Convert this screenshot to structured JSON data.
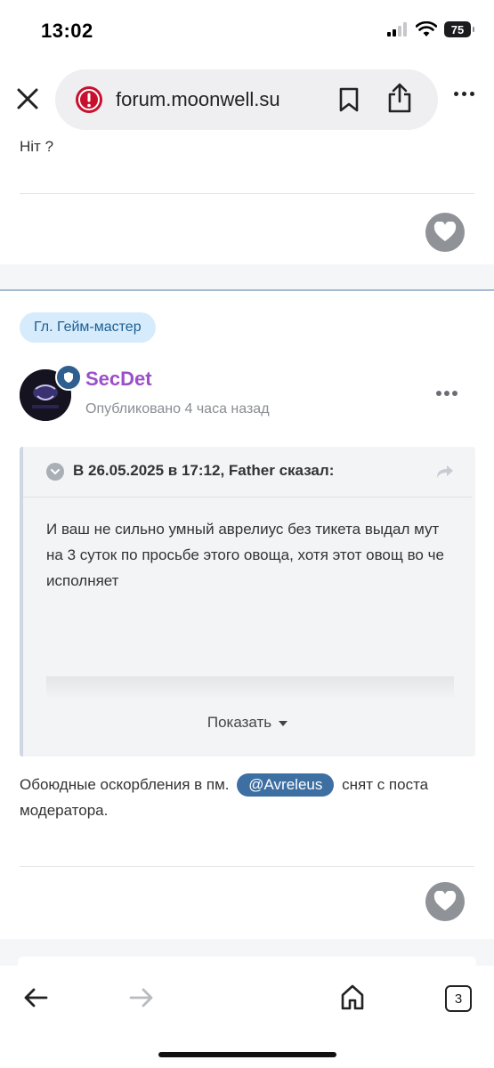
{
  "status_bar": {
    "time": "13:02",
    "battery": "75"
  },
  "browser": {
    "url": "forum.moonwell.su",
    "tab_count": "3"
  },
  "previous_post": {
    "cut_text": "Ніт ?"
  },
  "post": {
    "role_badge": "Гл. Гейм-мастер",
    "author": "SecDet",
    "posted_time": "Опубликовано 4 часа назад",
    "quote": {
      "header": "В 26.05.2025 в 17:12, Father сказал:",
      "body": "И ваш не сильно умный аврелиус без тикета выдал мут на 3 суток по просьбе этого овоща, хотя этот овощ во че исполняет",
      "expand_label": "Показать"
    },
    "text_before_mention": "Обоюдные оскорбления в пм.",
    "mention": "@Avreleus",
    "text_after_mention": "снят с поста модератора."
  },
  "colors": {
    "author": "#9b4fc9",
    "role_badge_bg": "#d6ebfb",
    "mention_bg": "#3d6fa3",
    "heart_bg": "#8f9297"
  }
}
